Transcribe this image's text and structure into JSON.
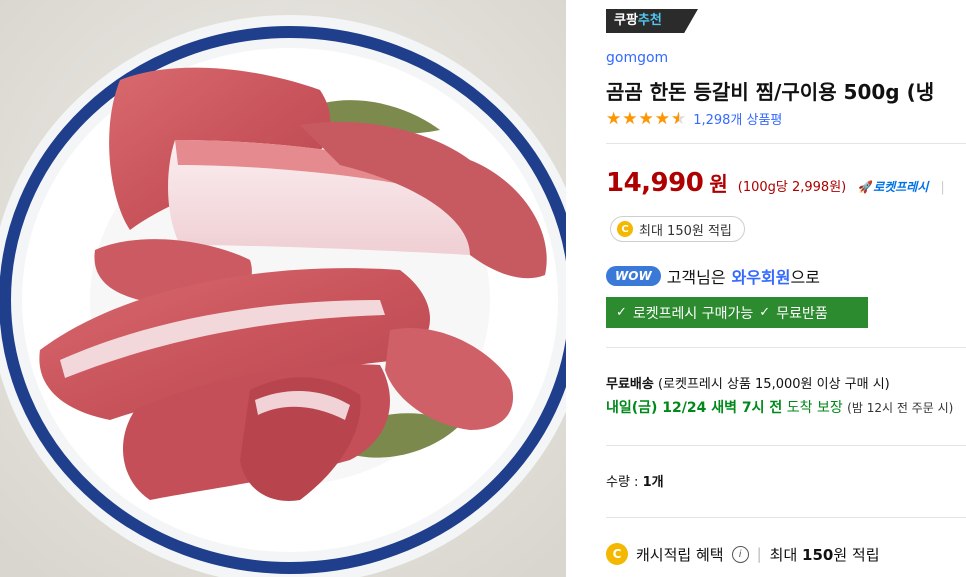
{
  "badge": {
    "part1": "쿠팡",
    "part2": "추천"
  },
  "brand": "gomgom",
  "title": "곰곰 한돈 등갈비 찜/구이용 500g (냉",
  "rating": {
    "stars": 4.5,
    "review_count": "1,298개 상품평"
  },
  "price": {
    "amount": "14,990",
    "currency": "원",
    "unit_price": "(100g당 2,998원)",
    "rocket_label": "로켓프레시",
    "separator": "|"
  },
  "reward_chip": {
    "coin": "C",
    "text": "최대 150원 적립"
  },
  "wow": {
    "pill": "WOW",
    "prefix": "고객님은",
    "link": "와우회원",
    "suffix": "으로"
  },
  "benefits": {
    "item1": "로켓프레시 구매가능",
    "item2": "무료반품"
  },
  "shipping": {
    "label": "무료배송",
    "detail": "(로켓프레시 상품 15,000원 이상 구매 시)",
    "eta_day": "내일(금) 12/24 새벽 7시 전",
    "eta_suffix": "도착 보장",
    "note": "(밤 12시 전 주문 시)"
  },
  "quantity": {
    "label": "수량 :",
    "value": "1개"
  },
  "cash": {
    "coin": "C",
    "label": "캐시적립 혜택",
    "info": "i",
    "separator": "|",
    "prefix": "최대",
    "amount": "150",
    "suffix": "원 적립"
  },
  "colors": {
    "price_red": "#ae0000",
    "link_blue": "#346aff",
    "star_orange": "#ff9600",
    "green": "#2c8a2f",
    "wow_blue": "#3a79d8"
  }
}
